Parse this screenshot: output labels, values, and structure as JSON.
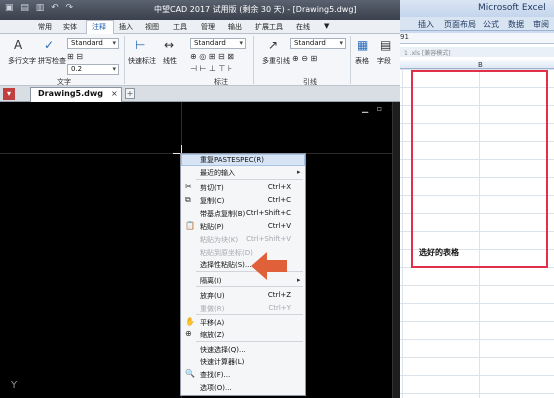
{
  "excel": {
    "title": "Microsoft Excel",
    "tabs": [
      "插入",
      "页面布局",
      "公式",
      "数据",
      "审阅"
    ],
    "name_box": "91",
    "doc_label": "1 .xls [兼容模式]",
    "column_header": "B",
    "selection_label": "选好的表格",
    "accent_color": "#e0304a"
  },
  "cad": {
    "title": "中望CAD 2017 试用版 (剩余 30 天) - [Drawing5.dwg]",
    "quick_access": "▣ ▤ ▥ ↶ ↷",
    "tabs": [
      "常用",
      "实体",
      "注释",
      "插入",
      "视图",
      "工具",
      "管理",
      "输出",
      "扩展工具",
      "在线"
    ],
    "active_tab_index": 2,
    "ribbon": {
      "text_group": {
        "label": "文字",
        "multiline_text": "多行文字",
        "spell_check": "拼写检查",
        "style_value": "Standard",
        "height_value": "0.2"
      },
      "dim_group": {
        "label": "标注",
        "quick_dim": "快速标注",
        "linear": "线性",
        "style_value": "Standard"
      },
      "leader_group": {
        "label": "引线",
        "multileader": "多重引线",
        "style_value": "Standard"
      },
      "table_button": "表格",
      "field_button": "字段"
    },
    "doc_tab": "Drawing5.dwg",
    "ucs_label": "Y"
  },
  "context_menu": {
    "items": [
      {
        "label": "重复PASTESPEC(R)",
        "shortcut": "",
        "disabled": false,
        "icon": "",
        "submenu": false
      },
      {
        "label": "最近的输入",
        "shortcut": "",
        "disabled": false,
        "icon": "",
        "submenu": true
      },
      {
        "label": "剪切(T)",
        "shortcut": "Ctrl+X",
        "disabled": false,
        "icon": "scissors-icon",
        "submenu": false
      },
      {
        "label": "复制(C)",
        "shortcut": "Ctrl+C",
        "disabled": false,
        "icon": "copy-icon",
        "submenu": false
      },
      {
        "label": "带基点复制(B)",
        "shortcut": "Ctrl+Shift+C",
        "disabled": false,
        "icon": "",
        "submenu": false
      },
      {
        "label": "粘贴(P)",
        "shortcut": "Ctrl+V",
        "disabled": false,
        "icon": "paste-icon",
        "submenu": false
      },
      {
        "label": "粘贴为块(K)",
        "shortcut": "Ctrl+Shift+V",
        "disabled": true,
        "icon": "",
        "submenu": false
      },
      {
        "label": "粘贴到原坐标(D)",
        "shortcut": "",
        "disabled": true,
        "icon": "",
        "submenu": false
      },
      {
        "label": "选择性粘贴(S)...",
        "shortcut": "",
        "disabled": false,
        "icon": "",
        "submenu": false
      },
      {
        "label": "隔离(I)",
        "shortcut": "",
        "disabled": false,
        "icon": "",
        "submenu": true
      },
      {
        "label": "放弃(U)",
        "shortcut": "Ctrl+Z",
        "disabled": false,
        "icon": "",
        "submenu": false
      },
      {
        "label": "重做(R)",
        "shortcut": "Ctrl+Y",
        "disabled": true,
        "icon": "",
        "submenu": false
      },
      {
        "label": "平移(A)",
        "shortcut": "",
        "disabled": false,
        "icon": "hand-icon",
        "submenu": false
      },
      {
        "label": "缩放(Z)",
        "shortcut": "",
        "disabled": false,
        "icon": "zoom-icon",
        "submenu": false
      },
      {
        "label": "快速选择(Q)...",
        "shortcut": "",
        "disabled": false,
        "icon": "",
        "submenu": false
      },
      {
        "label": "快速计算器(L)",
        "shortcut": "",
        "disabled": false,
        "icon": "",
        "submenu": false
      },
      {
        "label": "查找(F)...",
        "shortcut": "",
        "disabled": false,
        "icon": "find-icon",
        "submenu": false
      },
      {
        "label": "选项(O)...",
        "shortcut": "",
        "disabled": false,
        "icon": "",
        "submenu": false
      }
    ],
    "annotation_arrow_color": "#e0603a"
  }
}
